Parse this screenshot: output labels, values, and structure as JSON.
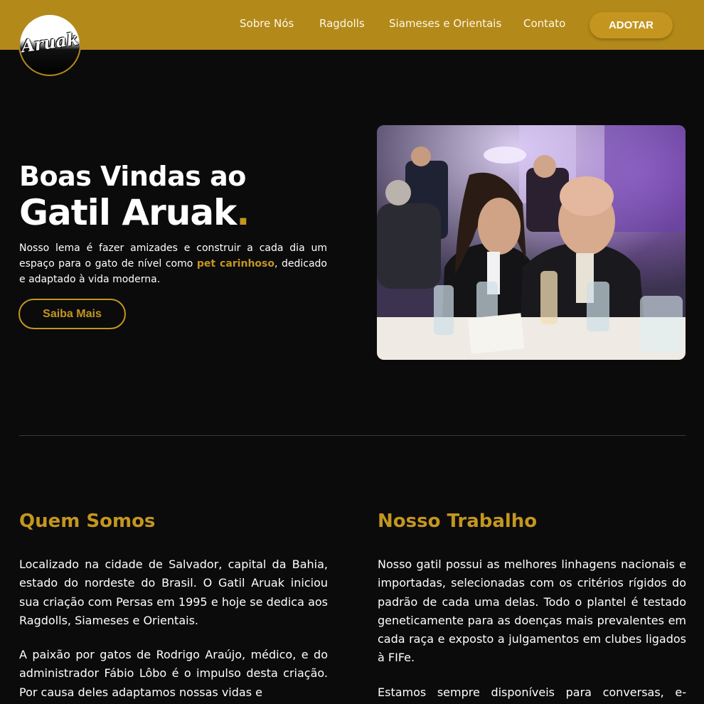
{
  "header": {
    "logo_text": "Aruak",
    "nav": [
      "Sobre Nós",
      "Ragdolls",
      "Siameses e Orientais",
      "Contato"
    ],
    "cta_label": "ADOTAR"
  },
  "hero": {
    "title_line1": "Boas Vindas ao",
    "title_line2": "Gatil Aruak",
    "title_dot": ".",
    "text_before": "Nosso lema é fazer amizades e construir a cada dia um espaço para o gato de nível como ",
    "text_highlight": "pet carinhoso",
    "text_after": ", dedicado e adaptado à vida moderna.",
    "button_label": "Saiba Mais"
  },
  "about": {
    "title": "Quem Somos",
    "paragraph1": "Localizado na cidade de Salvador, capital da Bahia, estado do nordeste do Brasil. O Gatil Aruak iniciou sua criação com Persas em 1995 e hoje se dedica aos Ragdolls, Siameses e Orientais.",
    "paragraph2": "A paixão por gatos de Rodrigo Araújo, médico, e do administrador Fábio Lôbo é o impulso desta criação. Por causa deles adaptamos nossas vidas e"
  },
  "work": {
    "title": "Nosso Trabalho",
    "paragraph1": "Nosso gatil possui as melhores linhagens nacionais e importadas, selecionadas com os critérios rígidos do padrão de cada uma delas. Todo o plantel é testado geneticamente para as doenças mais prevalentes em cada raça e exposto a julgamentos em clubes ligados à FIFe.",
    "paragraph2": "Estamos sempre disponíveis para conversas, e-"
  },
  "colors": {
    "header_bg": "#b3891a",
    "accent": "#c4961f",
    "page_bg": "#0b0b0c"
  }
}
